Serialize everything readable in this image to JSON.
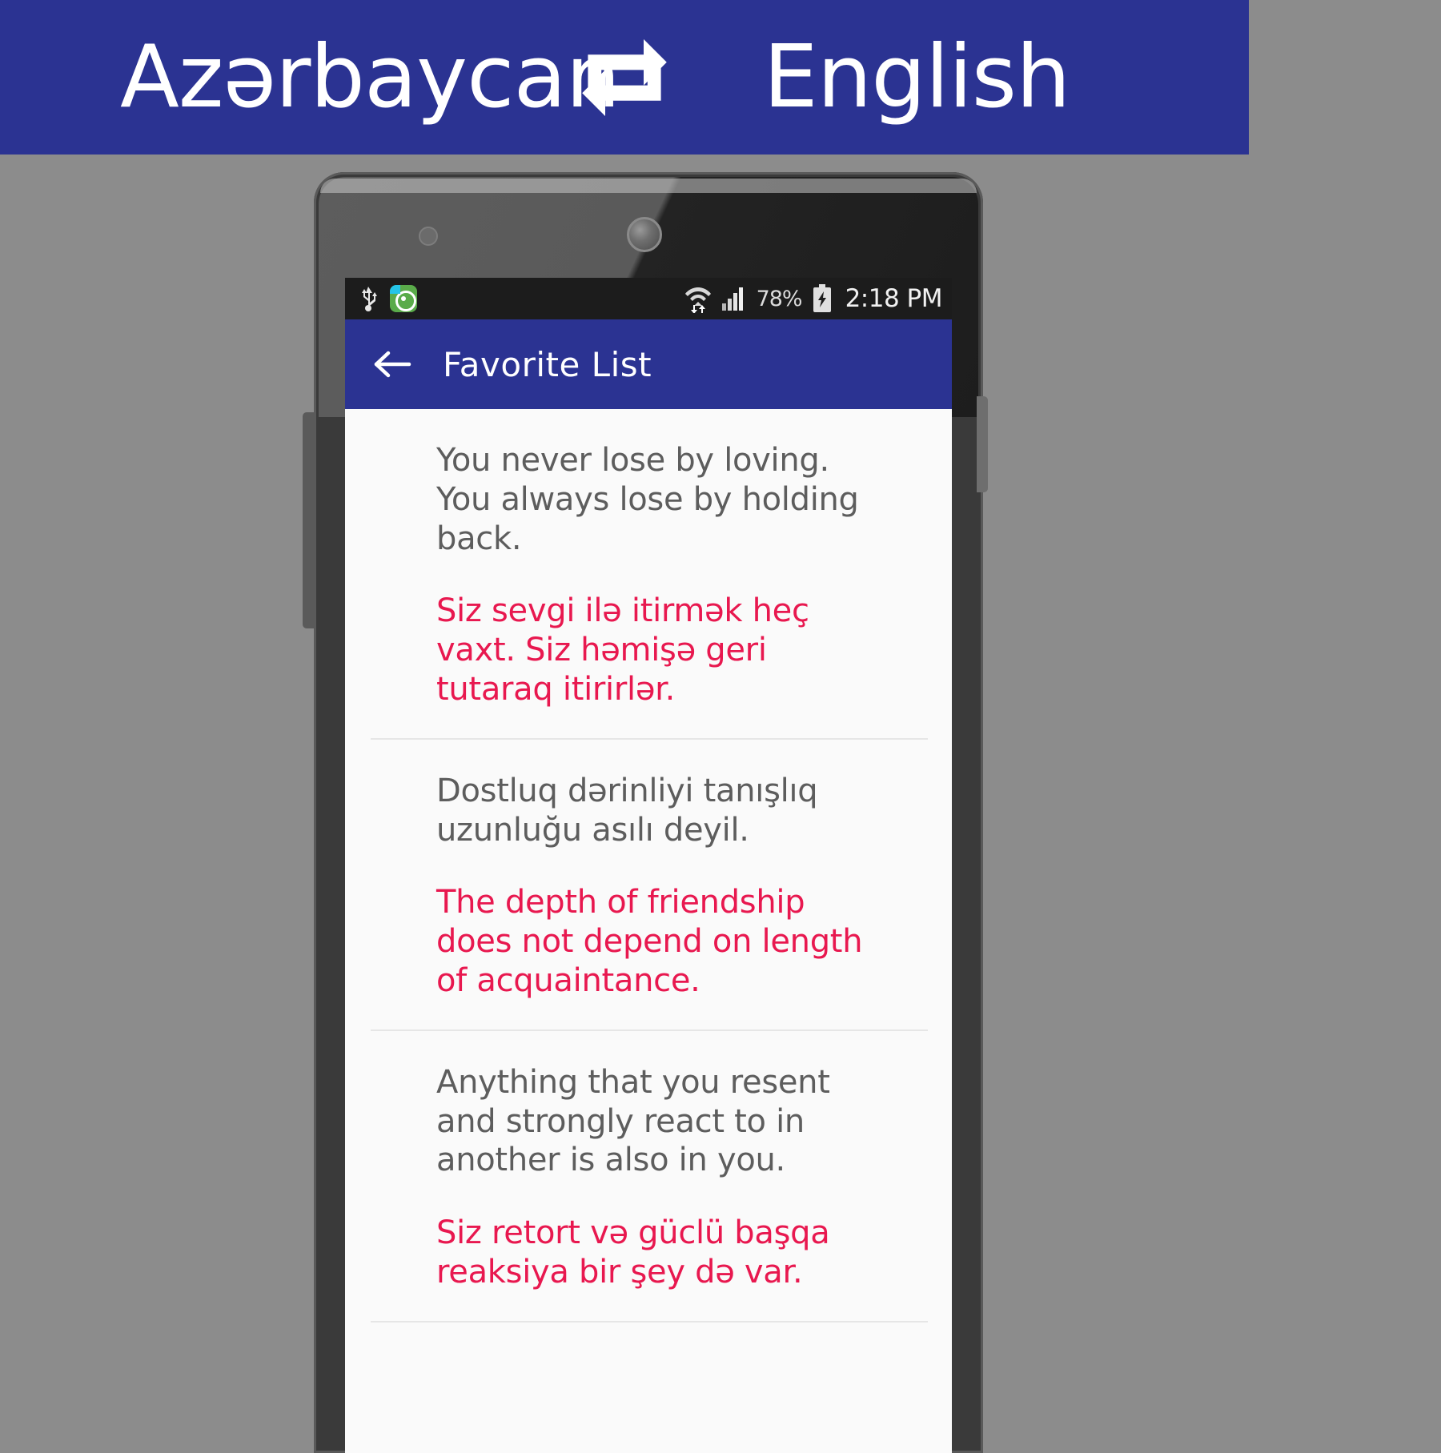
{
  "banner": {
    "source_language": "Azərbaycan",
    "target_language": "English",
    "swap_icon": "swap-repeat-icon",
    "background_color": "#2b3392",
    "text_color": "#ffffff"
  },
  "phone": {
    "status_bar": {
      "usb_icon": "usb-icon",
      "app_icon": "green-app-notification-icon",
      "wifi_icon": "wifi-with-data-transfer-icon",
      "signal_icon": "cellular-signal-icon",
      "battery_percent": "78%",
      "battery_icon": "battery-charging-icon",
      "time": "2:18 PM",
      "background_color": "#1c1c1c"
    },
    "toolbar": {
      "back_icon": "back-arrow-icon",
      "title": "Favorite List",
      "background_color": "#2b3392"
    },
    "list": {
      "source_text_color": "#5d5d5d",
      "translation_text_color": "#e8184f",
      "items": [
        {
          "source": "You never lose by loving. You always lose by holding back.",
          "translation": "Siz sevgi ilə itirmək heç vaxt. Siz həmişə geri tutaraq itirirlər."
        },
        {
          "source": "Dostluq dərinliyi tanışlıq uzunluğu asılı deyil.",
          "translation": "The depth of friendship does not depend on length of acquaintance."
        },
        {
          "source": "Anything that you resent and strongly react to in another is also in you.",
          "translation": "Siz retort və güclü başqa reaksiya bir şey də var."
        }
      ]
    }
  }
}
